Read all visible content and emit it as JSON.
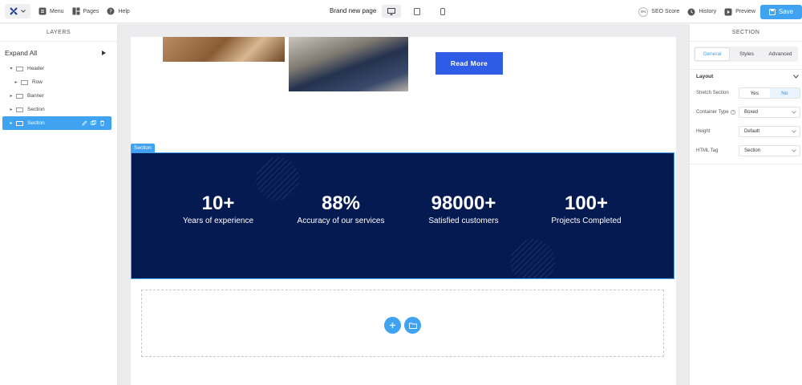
{
  "toolbar": {
    "menu_label": "Menu",
    "pages_label": "Pages",
    "help_label": "Help",
    "page_title": "Brand new page",
    "seo_badge": "0%",
    "seo_label": "SEO Score",
    "history_label": "History",
    "preview_label": "Preview",
    "save_label": "Save"
  },
  "layers": {
    "title": "LAYERS",
    "expand_all": "Expand All",
    "items": [
      {
        "label": "Header",
        "caret": "▾"
      },
      {
        "label": "Row",
        "caret": "▸"
      },
      {
        "label": "Banner",
        "caret": "▸"
      },
      {
        "label": "Section",
        "caret": "▸"
      },
      {
        "label": "Section",
        "caret": "▸"
      }
    ]
  },
  "canvas": {
    "read_more": "Read More",
    "section_tag": "Section",
    "stats": [
      {
        "num": "10+",
        "label": "Years of experience"
      },
      {
        "num": "88%",
        "label": "Accuracy of our services"
      },
      {
        "num": "98000+",
        "label": "Satisfied customers"
      },
      {
        "num": "100+",
        "label": "Projects Completed"
      }
    ]
  },
  "panel": {
    "title": "SECTION",
    "tabs": [
      "General",
      "Styles",
      "Advanced"
    ],
    "layout_label": "Layout",
    "stretch_label": "Stretch Section",
    "stretch_yes": "Yes",
    "stretch_no": "No",
    "container_label": "Container Type",
    "container_value": "Boxed",
    "height_label": "Height",
    "height_value": "Default",
    "html_tag_label": "HTML Tag",
    "html_tag_value": "Section"
  },
  "colors": {
    "accent": "#3fa3f1",
    "stats_bg": "#061a52",
    "read_more_bg": "#2f5ce6"
  }
}
